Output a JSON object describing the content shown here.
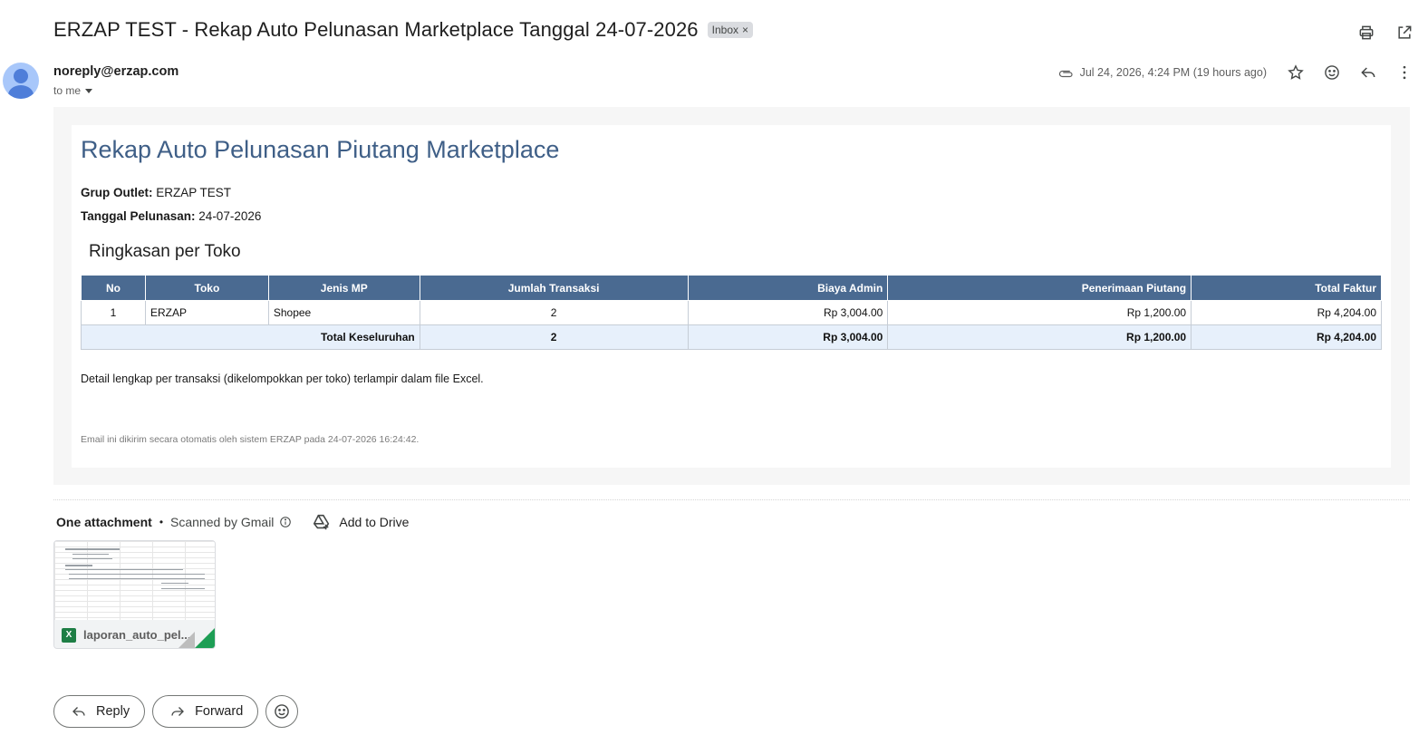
{
  "header": {
    "subject": "ERZAP TEST - Rekap Auto Pelunasan Marketplace Tanggal 24-07-2026",
    "label": "Inbox",
    "label_close": "×"
  },
  "sender": {
    "email": "noreply@erzap.com",
    "to": "to me",
    "date": "Jul 24, 2026, 4:24 PM (19 hours ago)"
  },
  "email_body": {
    "title": "Rekap Auto Pelunasan Piutang Marketplace",
    "grup_label": "Grup Outlet:",
    "grup_value": "ERZAP TEST",
    "tanggal_label": "Tanggal Pelunasan:",
    "tanggal_value": "24-07-2026",
    "section_title": "Ringkasan per Toko",
    "table": {
      "headers": [
        "No",
        "Toko",
        "Jenis MP",
        "Jumlah Transaksi",
        "Biaya Admin",
        "Penerimaan Piutang",
        "Total Faktur"
      ],
      "rows": [
        [
          "1",
          "ERZAP",
          "Shopee",
          "2",
          "Rp 3,004.00",
          "Rp 1,200.00",
          "Rp 4,204.00"
        ]
      ],
      "total": {
        "label": "Total Keseluruhan",
        "jumlah": "2",
        "biaya": "Rp 3,004.00",
        "penerimaan": "Rp 1,200.00",
        "total": "Rp 4,204.00"
      }
    },
    "detail_text": "Detail lengkap per transaksi (dikelompokkan per toko) terlampir dalam file Excel.",
    "footer_note": "Email ini dikirim secara otomatis oleh sistem ERZAP pada 24-07-2026 16:24:42."
  },
  "attachments": {
    "heading": "One attachment",
    "separator": "•",
    "scanned": "Scanned by Gmail",
    "add_to_drive": "Add to Drive",
    "file_name": "laporan_auto_pel...",
    "file_icon": "X"
  },
  "actions": {
    "reply": "Reply",
    "forward": "Forward"
  },
  "icons": {
    "print": "print-icon",
    "open_new": "open-in-new-window-icon",
    "attachment": "paperclip-icon",
    "star": "star-icon",
    "emoji": "emoji-icon",
    "reply": "reply-icon",
    "more": "more-vert-icon"
  },
  "colors": {
    "title_blue": "#3f5f87",
    "table_header": "#4a6a91",
    "total_row": "#e7f0fb",
    "excel_green": "#1e7e45"
  }
}
